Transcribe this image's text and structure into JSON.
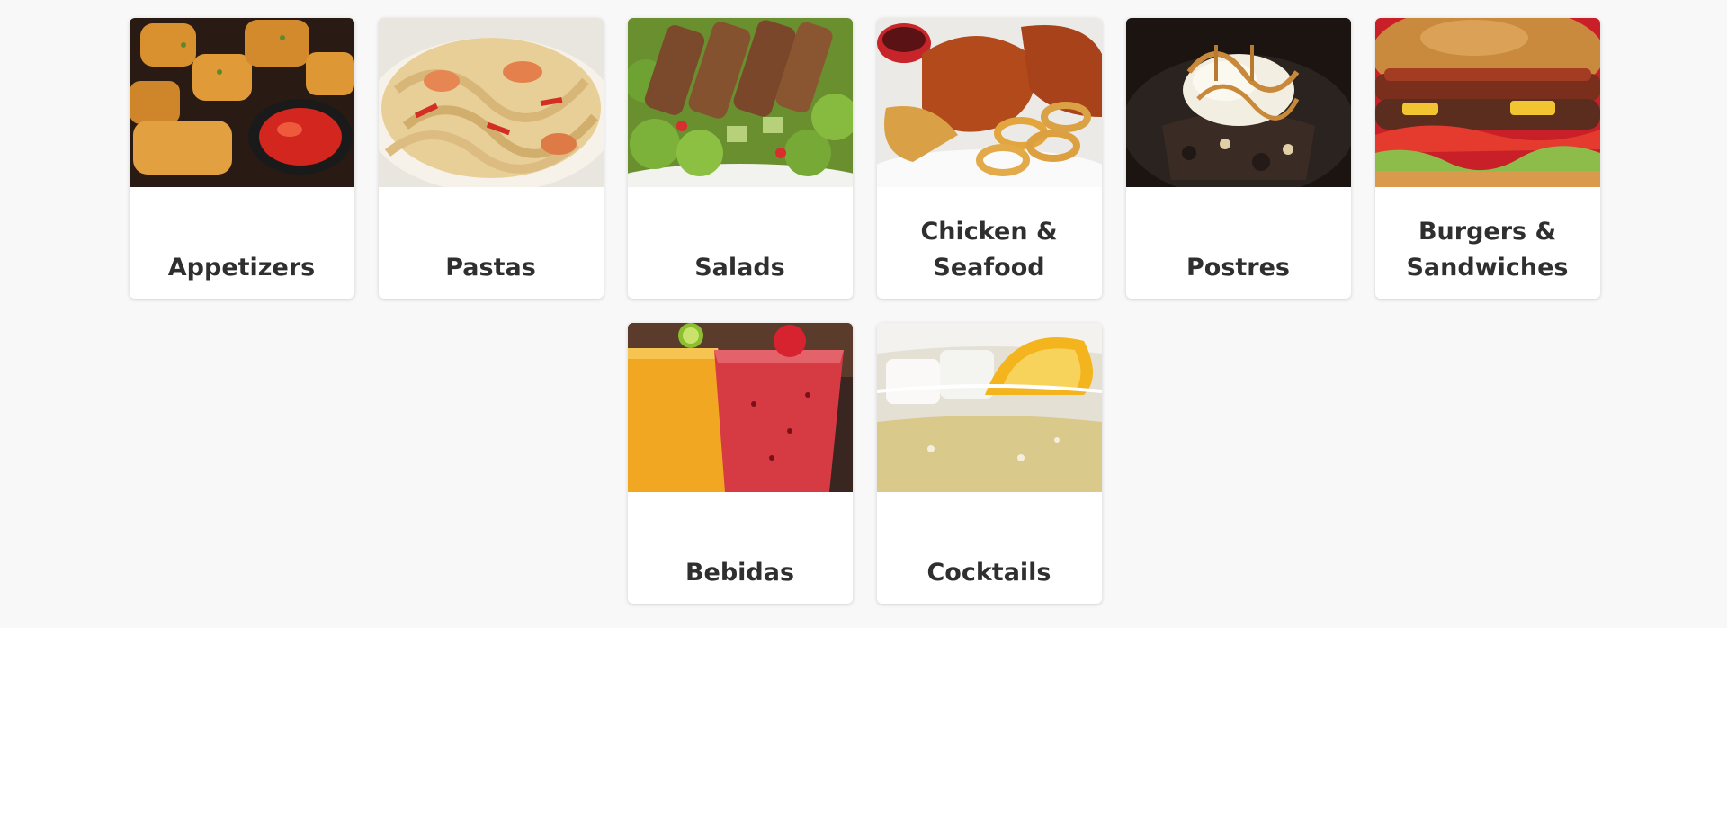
{
  "categories": [
    {
      "label": "Appetizers",
      "icon": "appetizers-photo"
    },
    {
      "label": "Pastas",
      "icon": "pasta-photo"
    },
    {
      "label": "Salads",
      "icon": "salad-photo"
    },
    {
      "label": "Chicken & Seafood",
      "icon": "chicken-seafood-photo"
    },
    {
      "label": "Postres",
      "icon": "dessert-photo"
    },
    {
      "label": "Burgers & Sandwiches",
      "icon": "burger-photo"
    },
    {
      "label": "Bebidas",
      "icon": "drinks-photo"
    },
    {
      "label": "Cocktails",
      "icon": "cocktail-photo"
    }
  ],
  "colors": {
    "section_bg": "#f8f8f8",
    "card_bg": "#ffffff",
    "label_text": "#2f2f2f"
  }
}
